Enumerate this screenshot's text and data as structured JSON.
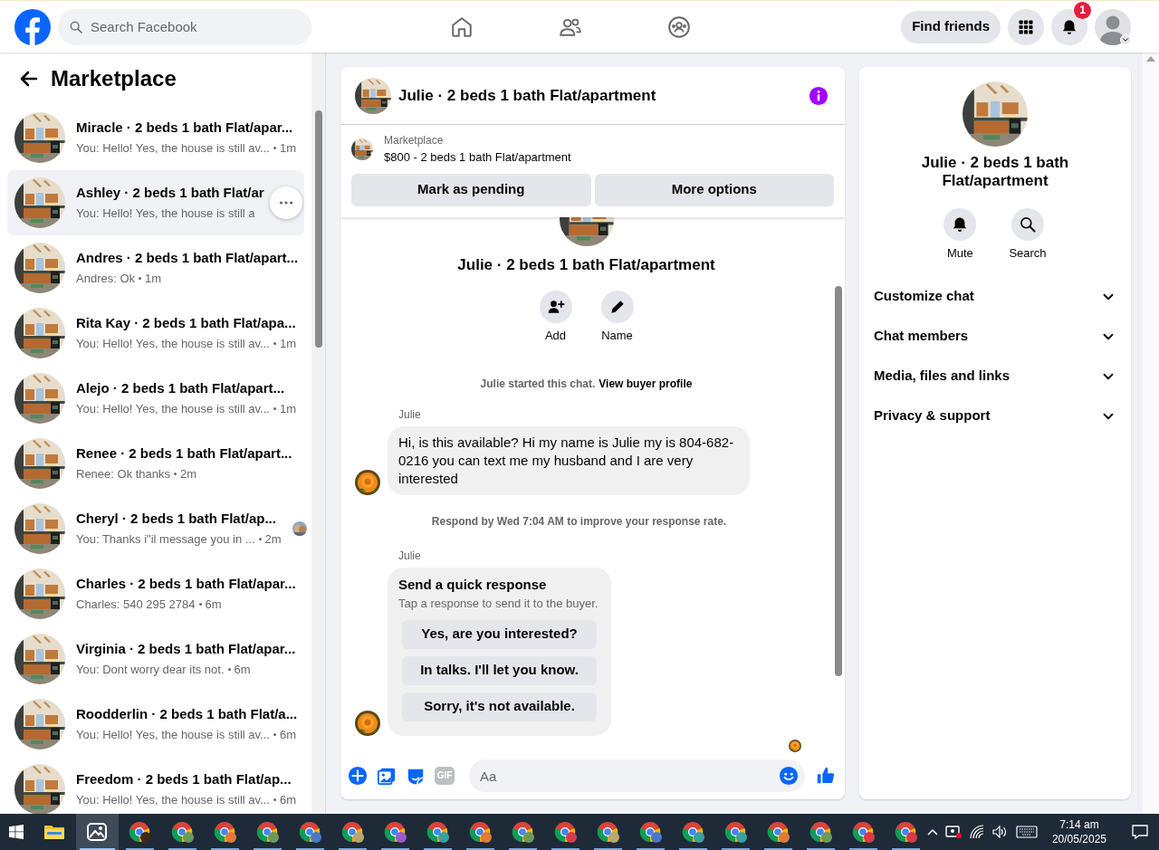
{
  "top_bar": {
    "search_placeholder": "Search Facebook",
    "nav": [
      {
        "kind": "home"
      },
      {
        "kind": "friends"
      },
      {
        "kind": "groups"
      }
    ],
    "find_friends": "Find friends",
    "notification_count": "1"
  },
  "sidebar": {
    "title": "Marketplace",
    "conversations": [
      {
        "title": "Miracle · 2 beds 1 bath Flat/apar...",
        "preview": "You: Hello! Yes, the house is still av...",
        "time": "1m",
        "selected": false
      },
      {
        "title": "Ashley · 2 beds 1 bath Flat/ar",
        "preview": "You: Hello! Yes, the house is still a",
        "selected": true
      },
      {
        "title": "Andres · 2 beds 1 bath Flat/apart...",
        "preview": "Andres: Ok",
        "time": "1m",
        "selected": false
      },
      {
        "title": "Rita Kay · 2 beds 1 bath Flat/apa...",
        "preview": "You: Hello! Yes, the house is still av...",
        "time": "1m",
        "selected": false
      },
      {
        "title": "Alejo · 2 beds 1 bath Flat/apart...",
        "preview": "You: Hello! Yes, the house is still av...",
        "time": "1m",
        "selected": false
      },
      {
        "title": "Renee · 2 beds 1 bath Flat/apart...",
        "preview": "Renee: Ok thanks",
        "time": "2m",
        "selected": false
      },
      {
        "title": "Cheryl · 2 beds 1 bath Flat/ap...",
        "preview": "You: Thanks i\"il message you in ...",
        "time": "2m",
        "selected": false,
        "seen": true
      },
      {
        "title": "Charles · 2 beds 1 bath Flat/apar...",
        "preview": "Charles: 540 295 2784",
        "time": "6m",
        "selected": false
      },
      {
        "title": "Virginia · 2 beds 1 bath Flat/apar...",
        "preview": "You: Dont worry dear its not.",
        "time": "6m",
        "selected": false
      },
      {
        "title": "Roodderlin · 2 beds 1 bath Flat/a...",
        "preview": "You: Hello! Yes, the house is still av...",
        "time": "6m",
        "selected": false
      },
      {
        "title": "Freedom · 2 beds 1 bath Flat/ap...",
        "preview": "You: Hello! Yes, the house is still av...",
        "time": "6m",
        "selected": false
      }
    ]
  },
  "chat": {
    "title": "Julie · 2 beds 1 bath Flat/apartment",
    "listing_label": "Marketplace",
    "listing": "$800 - 2 beds 1 bath Flat/apartment",
    "buttons": [
      "Mark as pending",
      "More options"
    ],
    "intro_name": "Julie · 2 beds 1 bath Flat/apartment",
    "intro_actions": [
      {
        "kind": "add",
        "label": "Add"
      },
      {
        "kind": "name",
        "label": "Name"
      }
    ],
    "started_text": "Julie started this chat.",
    "started_link": "View buyer profile",
    "items": [
      {
        "kind": "message",
        "sender": "Julie",
        "text": "Hi, is this available? Hi my name is Julie my  is 804-682-0216 you can text me my husband and I are very interested"
      },
      {
        "kind": "notice",
        "text": "Respond by Wed 7:04 AM to improve your response rate."
      },
      {
        "kind": "quick",
        "sender": "Julie",
        "title": "Send a quick response",
        "subtitle": "Tap a response to send it to the buyer.",
        "options": [
          "Yes, are you interested?",
          "In talks. I'll let you know.",
          "Sorry, it's not available."
        ]
      }
    ],
    "composer": {
      "placeholder": "Aa",
      "gif_label": "GIF"
    }
  },
  "details": {
    "title": "Julie · 2 beds 1 bath Flat/apartment",
    "actions": [
      {
        "kind": "mute",
        "label": "Mute"
      },
      {
        "kind": "search",
        "label": "Search"
      }
    ],
    "sections": [
      {
        "label": "Customize chat",
        "expanded": false
      },
      {
        "label": "Chat members",
        "expanded": false
      },
      {
        "label": "Media, files and links",
        "expanded": false
      },
      {
        "label": "Privacy & support",
        "expanded": false
      }
    ]
  },
  "taskbar": {
    "apps": [
      {
        "kind": "explorer",
        "selected": false
      },
      {
        "kind": "photos",
        "selected": true
      },
      {
        "kind": "chrome",
        "color": "#3a2a1a",
        "selected": false
      },
      {
        "kind": "chrome",
        "color": "#6a9a5a",
        "selected": false
      },
      {
        "kind": "chrome",
        "color": "#e07a3a",
        "selected": false
      },
      {
        "kind": "chrome",
        "color": "#6a9a5a",
        "selected": false
      },
      {
        "kind": "chrome",
        "color": "#4a78c8",
        "selected": false
      },
      {
        "kind": "chrome",
        "color": "#b8a870",
        "selected": false
      },
      {
        "kind": "chrome",
        "color": "#9a5ac8",
        "selected": false
      },
      {
        "kind": "chrome",
        "color": "#3aa0a0",
        "selected": false
      },
      {
        "kind": "chrome",
        "color": "#e07a3a",
        "selected": false
      },
      {
        "kind": "chrome",
        "color": "#6a9a5a",
        "selected": false
      },
      {
        "kind": "chrome",
        "color": "#d83a4a",
        "selected": false
      },
      {
        "kind": "chrome",
        "color": "#b8a870",
        "selected": false
      },
      {
        "kind": "chrome",
        "color": "#4a78c8",
        "selected": false
      },
      {
        "kind": "chrome",
        "color": "#3aa0a0",
        "selected": false
      },
      {
        "kind": "chrome",
        "color": "#3aa0a0",
        "selected": false
      },
      {
        "kind": "chrome",
        "color": "#e07a3a",
        "selected": false
      },
      {
        "kind": "chrome",
        "color": "#6a9a5a",
        "selected": false
      },
      {
        "kind": "chrome",
        "color": "#d83a4a",
        "selected": false
      },
      {
        "kind": "chrome",
        "color": "#d83a4a",
        "selected": false
      }
    ],
    "time": "7:14 am",
    "date": "20/05/2025"
  }
}
